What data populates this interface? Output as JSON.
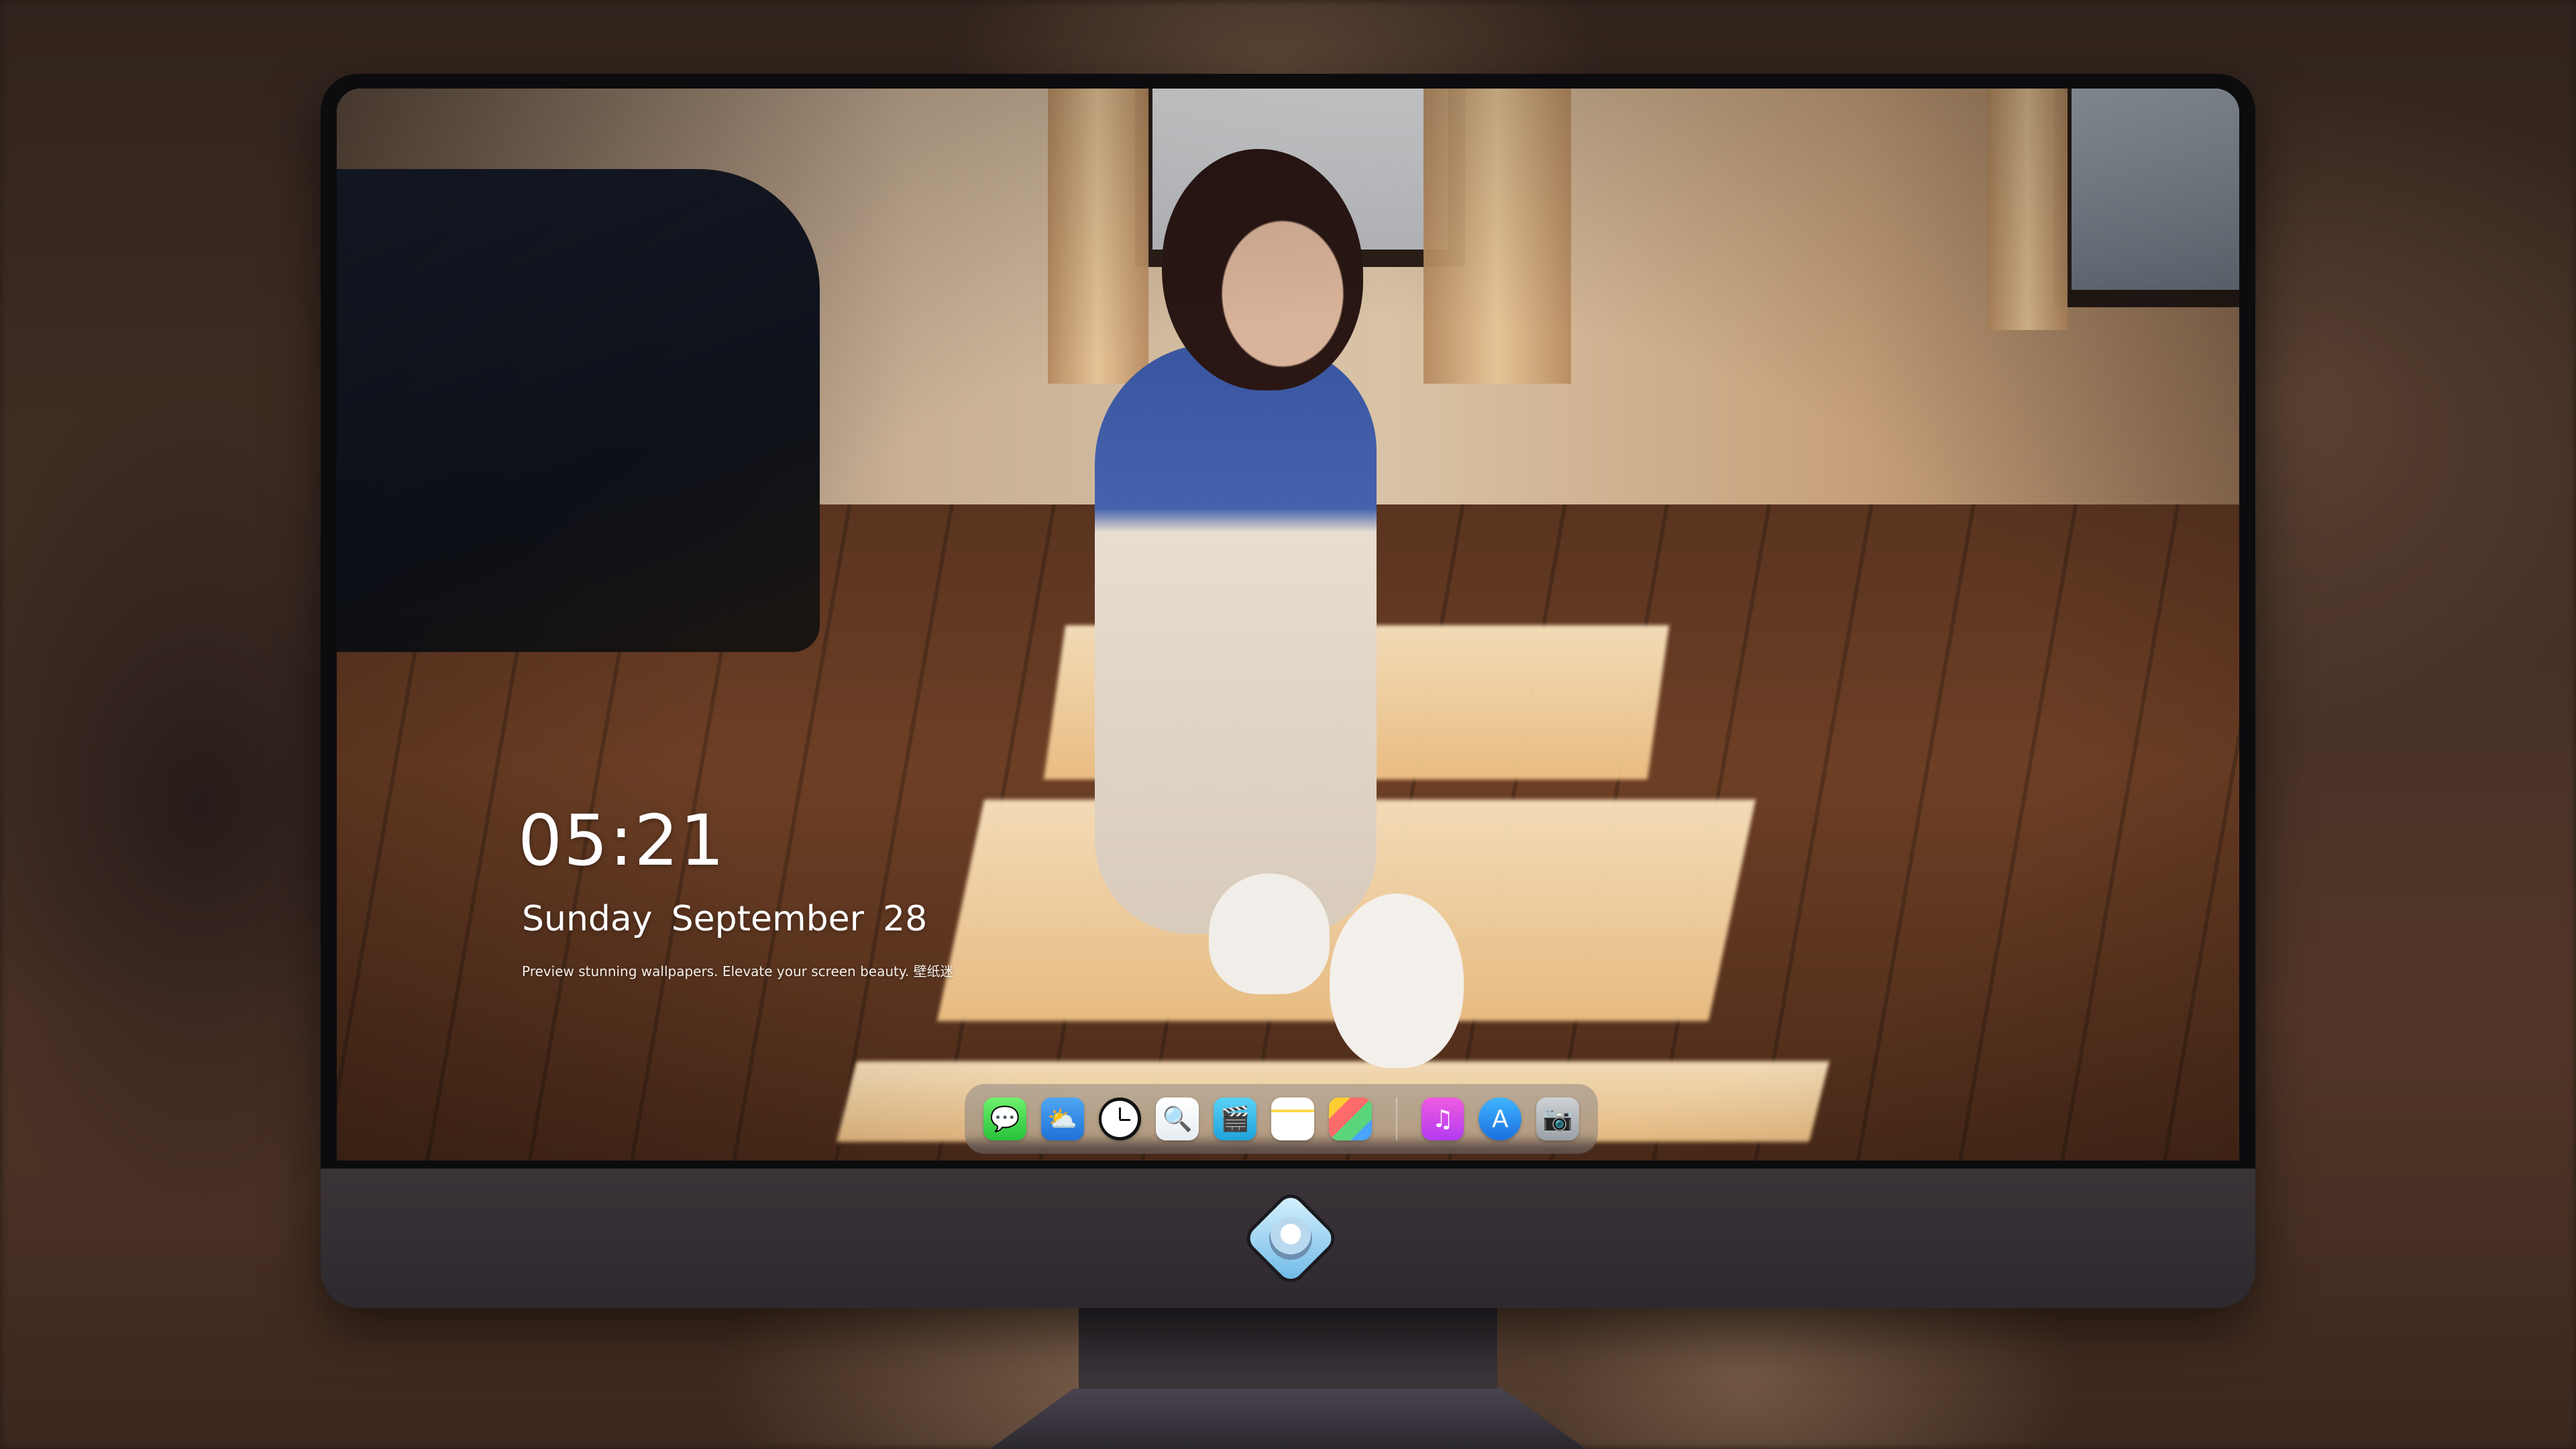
{
  "lock_screen": {
    "time": "05:21",
    "weekday": "Sunday",
    "month": "September",
    "day": "28",
    "tagline": "Preview stunning wallpapers. Elevate your screen beauty. 壁纸迷"
  },
  "dock": {
    "apps": [
      {
        "name": "Messages",
        "icon": "messages-icon",
        "glyph": "💬"
      },
      {
        "name": "Weather",
        "icon": "weather-icon",
        "glyph": "⛅"
      },
      {
        "name": "Clock",
        "icon": "clock-icon",
        "glyph": ""
      },
      {
        "name": "Preview",
        "icon": "preview-icon",
        "glyph": "🔍"
      },
      {
        "name": "Clips",
        "icon": "clapperboard-icon",
        "glyph": "🎬"
      },
      {
        "name": "Notes",
        "icon": "notes-icon",
        "glyph": ""
      },
      {
        "name": "Photos",
        "icon": "photos-icon",
        "glyph": ""
      },
      {
        "name": "Music",
        "icon": "music-icon",
        "glyph": "♫"
      },
      {
        "name": "App Store",
        "icon": "app-store-icon",
        "glyph": "A"
      },
      {
        "name": "Camera",
        "icon": "camera-icon",
        "glyph": "📷"
      }
    ]
  },
  "colors": {
    "bezel": "#0c0c0e",
    "chin": "#332e33",
    "dock_bg": "rgba(120,120,128,.45)",
    "text": "#ffffff"
  }
}
